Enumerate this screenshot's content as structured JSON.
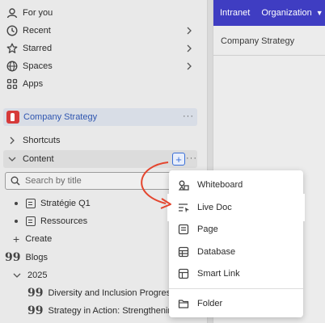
{
  "sidebar": {
    "nav": [
      {
        "label": "For you",
        "icon": "for-you-icon"
      },
      {
        "label": "Recent",
        "icon": "clock-icon"
      },
      {
        "label": "Starred",
        "icon": "star-icon"
      },
      {
        "label": "Spaces",
        "icon": "globe-icon"
      },
      {
        "label": "Apps",
        "icon": "apps-icon"
      }
    ],
    "space_name": "Company Strategy",
    "shortcuts_label": "Shortcuts",
    "content_label": "Content",
    "search_placeholder": "Search by title",
    "tree": [
      {
        "label": "Stratégie Q1"
      },
      {
        "label": "Ressources"
      }
    ],
    "create_label": "Create",
    "blogs_label": "Blogs",
    "year_label": "2025",
    "posts": [
      {
        "label": "Diversity and Inclusion Progress R"
      },
      {
        "label": "Strategy in Action: Strengthening C"
      }
    ]
  },
  "topbar": {
    "intranet": "Intranet",
    "organization": "Organization"
  },
  "page": {
    "title": "Company Strategy"
  },
  "menu": {
    "items": [
      {
        "label": "Whiteboard",
        "icon": "whiteboard-icon"
      },
      {
        "label": "Live Doc",
        "icon": "live-doc-icon"
      },
      {
        "label": "Page",
        "icon": "page-icon"
      },
      {
        "label": "Database",
        "icon": "database-icon"
      },
      {
        "label": "Smart Link",
        "icon": "smart-link-icon"
      },
      {
        "label": "Folder",
        "icon": "folder-icon"
      }
    ]
  },
  "colors": {
    "accent": "#3f3dc2",
    "arrow": "#e4462f",
    "link": "#2f56b0"
  }
}
